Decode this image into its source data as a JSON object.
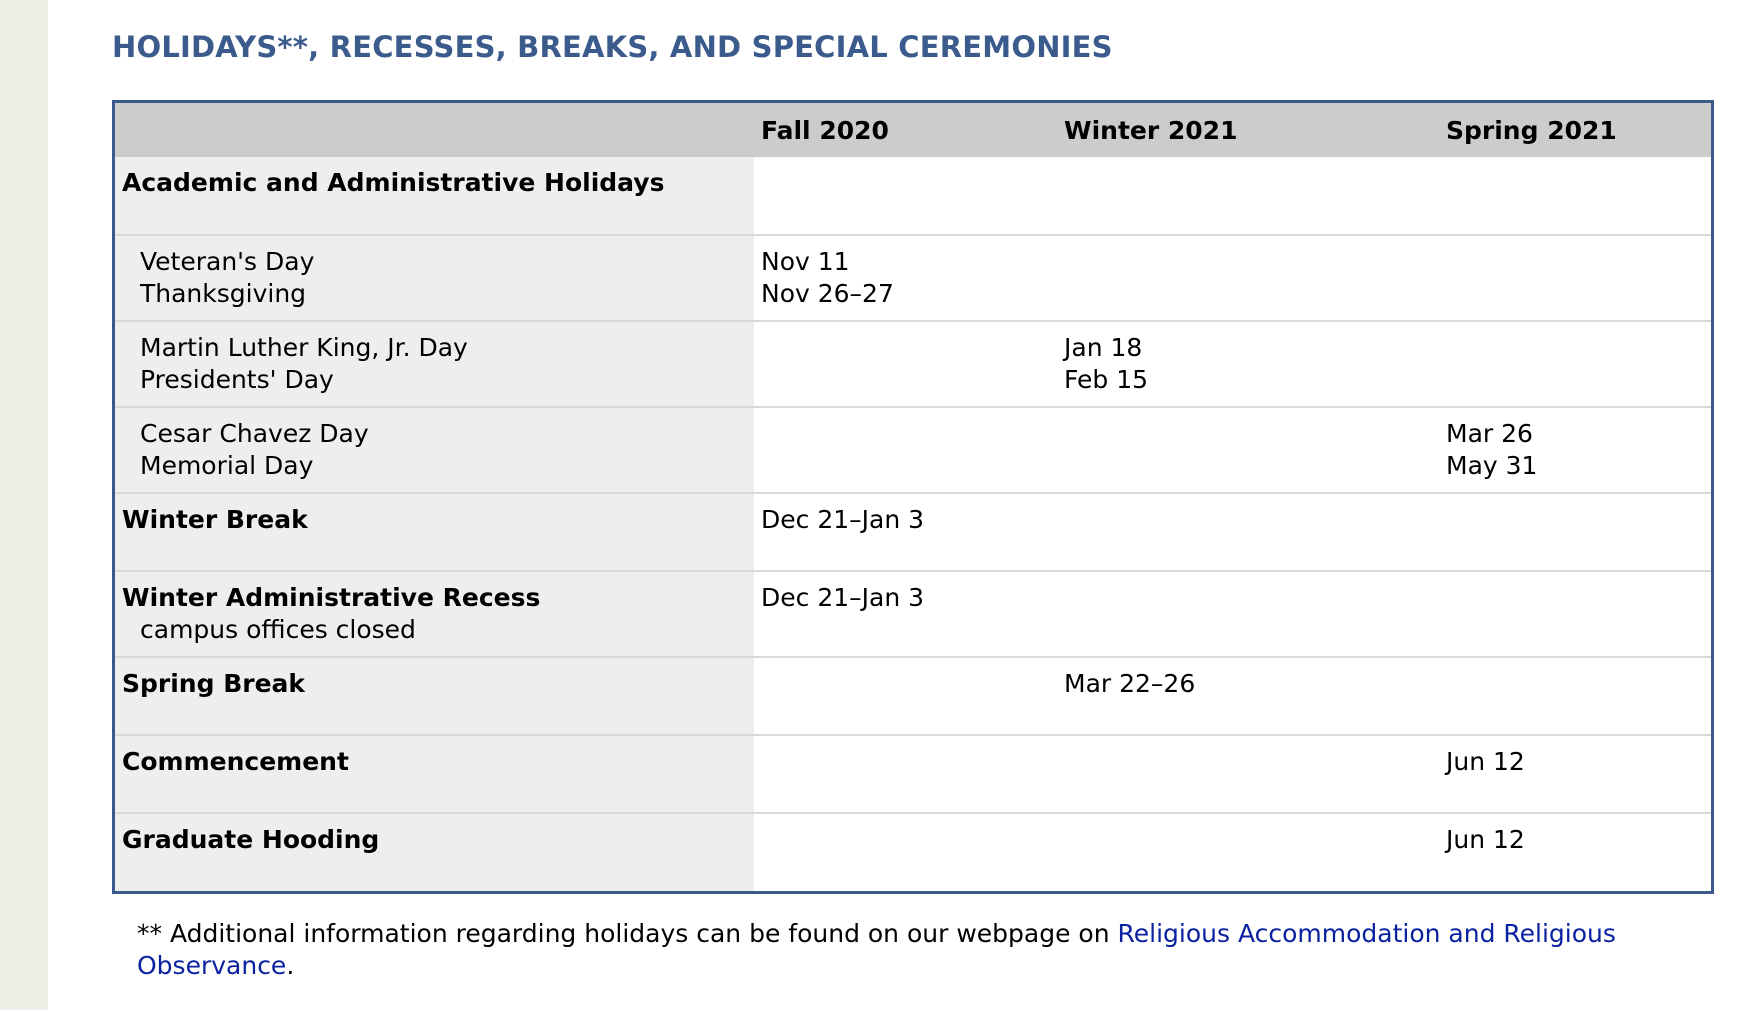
{
  "title": "HOLIDAYS**, RECESSES, BREAKS, AND SPECIAL CEREMONIES",
  "table": {
    "headers": [
      "",
      "Fall 2020",
      "Winter 2021",
      "Spring 2021"
    ],
    "rows": [
      {
        "label_bold": "Academic and Administrative Holidays",
        "label_lines": [],
        "fall": [],
        "winter": [],
        "spring": []
      },
      {
        "label_bold": "",
        "label_lines": [
          "Veteran's Day",
          "Thanksgiving"
        ],
        "fall": [
          "Nov 11",
          "Nov 26–27"
        ],
        "winter": [],
        "spring": []
      },
      {
        "label_bold": "",
        "label_lines": [
          "Martin Luther King, Jr. Day",
          "Presidents' Day"
        ],
        "fall": [],
        "winter": [
          "Jan 18",
          "Feb 15"
        ],
        "spring": []
      },
      {
        "label_bold": "",
        "label_lines": [
          "Cesar Chavez Day",
          "Memorial Day"
        ],
        "fall": [],
        "winter": [],
        "spring": [
          "Mar 26",
          "May 31"
        ]
      },
      {
        "label_bold": "Winter Break",
        "label_lines": [],
        "fall": [
          "Dec 21–Jan 3"
        ],
        "winter": [],
        "spring": []
      },
      {
        "label_bold": "Winter Administrative Recess",
        "label_lines": [
          "campus offices closed"
        ],
        "fall": [
          "Dec 21–Jan 3"
        ],
        "winter": [],
        "spring": []
      },
      {
        "label_bold": "Spring Break",
        "label_lines": [],
        "fall": [],
        "winter": [
          "Mar 22–26"
        ],
        "spring": []
      },
      {
        "label_bold": "Commencement",
        "label_lines": [],
        "fall": [],
        "winter": [],
        "spring": [
          "Jun 12"
        ]
      },
      {
        "label_bold": "Graduate Hooding",
        "label_lines": [],
        "fall": [],
        "winter": [],
        "spring": [
          "Jun 12"
        ]
      }
    ]
  },
  "footnote": {
    "prefix": "** Additional information regarding holidays can be found on our webpage on ",
    "link_text": "Religious Accommodation and Religious Observance",
    "suffix": "."
  },
  "colors": {
    "title": "#3b5b8c",
    "table_border": "#3b5b8c",
    "header_bg": "#cccccc",
    "label_bg": "#eeeeee",
    "link": "#0a22a0",
    "gutter": "#efefe8"
  }
}
